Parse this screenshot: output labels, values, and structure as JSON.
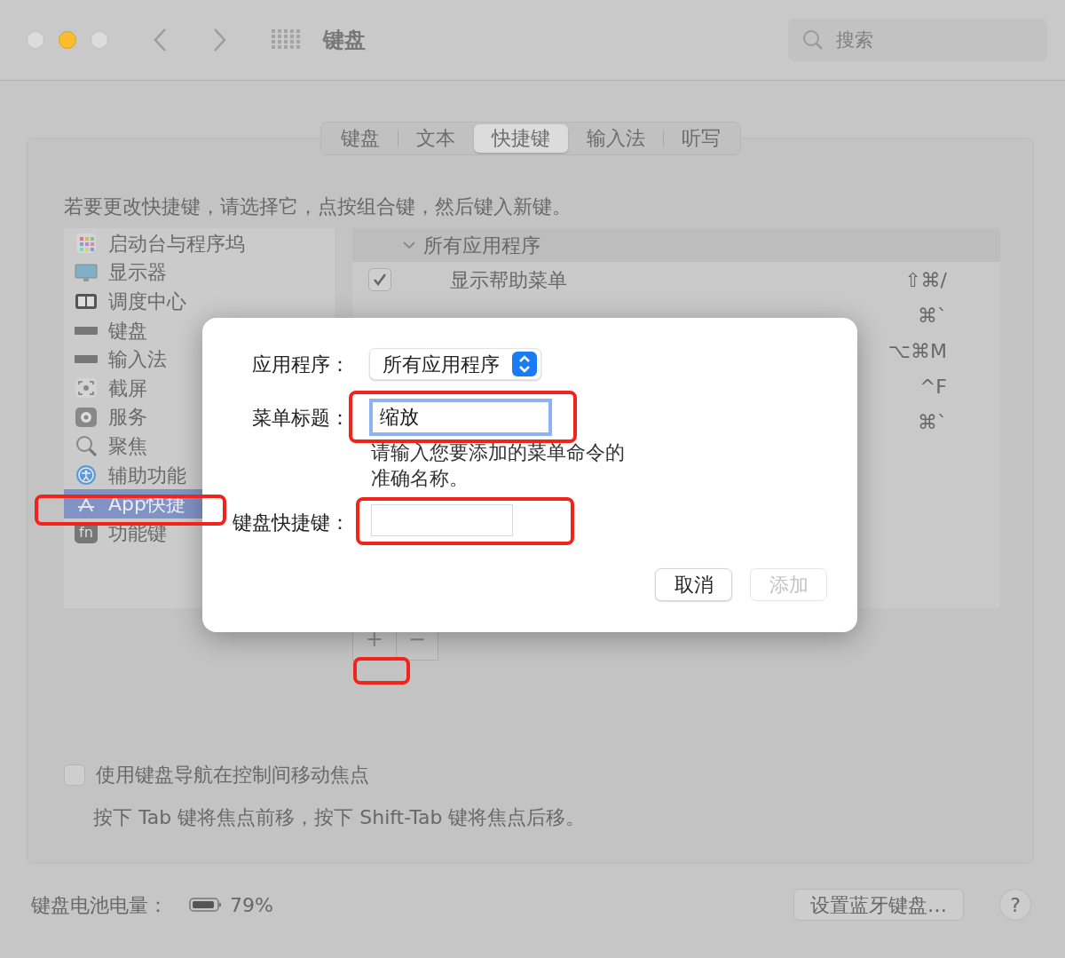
{
  "window": {
    "title": "键盘",
    "search": {
      "placeholder": "搜索"
    }
  },
  "tabs": [
    {
      "label": "键盘",
      "selected": false
    },
    {
      "label": "文本",
      "selected": false
    },
    {
      "label": "快捷键",
      "selected": true
    },
    {
      "label": "输入法",
      "selected": false
    },
    {
      "label": "听写",
      "selected": false
    }
  ],
  "instruction": "若要更改快捷键，请选择它，点按组合键，然后键入新键。",
  "sidebar": {
    "items": [
      {
        "label": "启动台与程序坞",
        "selected": false
      },
      {
        "label": "显示器",
        "selected": false
      },
      {
        "label": "调度中心",
        "selected": false
      },
      {
        "label": "键盘",
        "selected": false
      },
      {
        "label": "输入法",
        "selected": false
      },
      {
        "label": "截屏",
        "selected": false
      },
      {
        "label": "服务",
        "selected": false
      },
      {
        "label": "聚焦",
        "selected": false
      },
      {
        "label": "辅助功能",
        "selected": false
      },
      {
        "label": "App快捷",
        "selected": true
      },
      {
        "label": "功能键",
        "selected": false,
        "key_text": "fn"
      }
    ]
  },
  "shortcuts": {
    "group": {
      "label": "所有应用程序",
      "expanded": true
    },
    "rows": [
      {
        "checked": true,
        "label": "显示帮助菜单",
        "keys": "⇧⌘/"
      },
      {
        "keys": "⌘`"
      },
      {
        "keys": "⌥⌘M"
      },
      {
        "keys": "^F"
      },
      {
        "keys": "⌘`"
      }
    ]
  },
  "list_buttons": [
    "+",
    "−"
  ],
  "keyboard_navigation": {
    "checked": false,
    "label": "使用键盘导航在控制间移动焦点",
    "hint": "按下 Tab 键将焦点前移，按下 Shift-Tab 键将焦点后移。"
  },
  "footer": {
    "battery_label": "键盘电池电量：",
    "battery_reading": "79%",
    "setup_button": "设置蓝牙键盘…",
    "help": "?"
  },
  "dialog": {
    "application_label": "应用程序：",
    "application_value": "所有应用程序",
    "menu_title_label": "菜单标题：",
    "menu_title_value": "缩放",
    "hint": "请输入您要添加的菜单命令的准确名称。",
    "shortcut_label": "键盘快捷键：",
    "buttons": [
      {
        "label": "取消",
        "disabled": false
      },
      {
        "label": "添加",
        "disabled": true
      }
    ]
  }
}
